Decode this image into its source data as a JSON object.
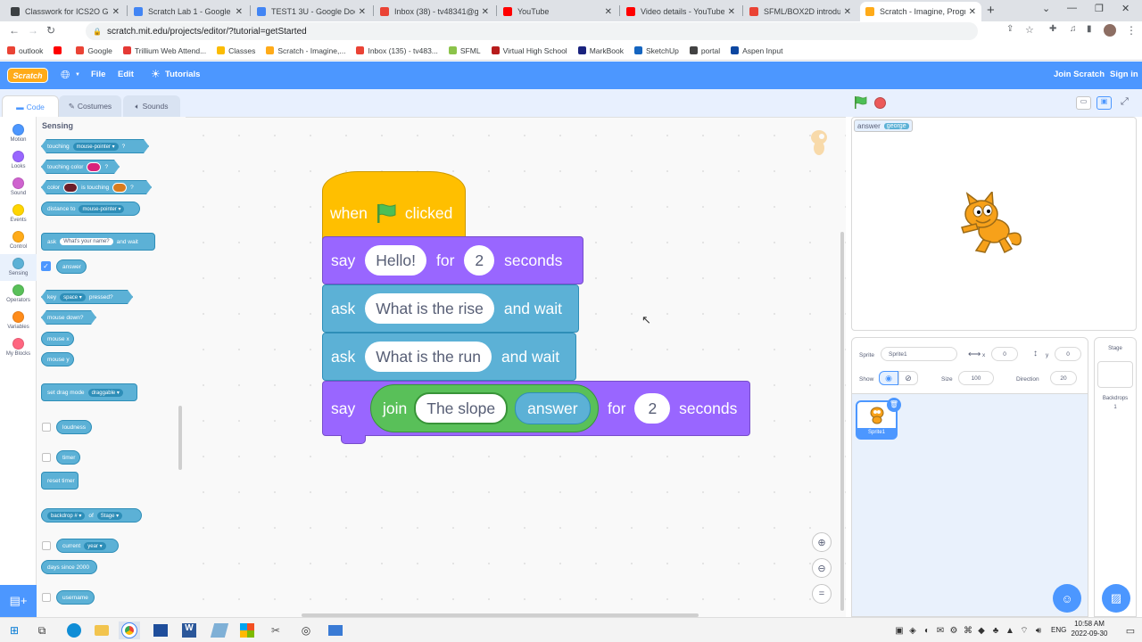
{
  "browser": {
    "tabs": [
      {
        "title": "Classwork for ICS2O Grade",
        "color": "#3c4043"
      },
      {
        "title": "Scratch Lab 1 - Google Do",
        "color": "#4285f4"
      },
      {
        "title": "TEST1 3U - Google Docs",
        "color": "#4285f4"
      },
      {
        "title": "Inbox (38) - tv48341@got",
        "color": "#ea4335"
      },
      {
        "title": "YouTube",
        "color": "#ff0000"
      },
      {
        "title": "Video details - YouTube St",
        "color": "#ff0000"
      },
      {
        "title": "SFML/BOX2D introduction",
        "color": "#ea4335"
      },
      {
        "title": "Scratch - Imagine, Program",
        "color": "#ffab19"
      }
    ],
    "url": "scratch.mit.edu/projects/editor/?tutorial=getStarted",
    "bookmarks": [
      {
        "label": "outlook",
        "color": "#ea4335"
      },
      {
        "label": "",
        "color": "#ff0000"
      },
      {
        "label": "Google",
        "color": "#ea4335"
      },
      {
        "label": "Trillium Web Attend...",
        "color": "#e53935"
      },
      {
        "label": "Classes",
        "color": "#fbbc04"
      },
      {
        "label": "Scratch - Imagine,...",
        "color": "#ffab19"
      },
      {
        "label": "Inbox (135) - tv483...",
        "color": "#ea4335"
      },
      {
        "label": "SFML",
        "color": "#8bc34a"
      },
      {
        "label": "Virtual High School",
        "color": "#b71c1c"
      },
      {
        "label": "MarkBook",
        "color": "#1a237e"
      },
      {
        "label": "SketchUp",
        "color": "#1565c0"
      },
      {
        "label": "portal",
        "color": "#424242"
      },
      {
        "label": "Aspen Input",
        "color": "#0d47a1"
      }
    ]
  },
  "menu": {
    "logo": "Scratch",
    "file": "File",
    "edit": "Edit",
    "tutorials": "Tutorials",
    "join": "Join Scratch",
    "signin": "Sign in"
  },
  "editor_tabs": {
    "code": "Code",
    "costumes": "Costumes",
    "sounds": "Sounds"
  },
  "categories": [
    {
      "label": "Motion",
      "color": "#4c97ff"
    },
    {
      "label": "Looks",
      "color": "#9966ff"
    },
    {
      "label": "Sound",
      "color": "#cf63cf"
    },
    {
      "label": "Events",
      "color": "#ffd500"
    },
    {
      "label": "Control",
      "color": "#ffab19"
    },
    {
      "label": "Sensing",
      "color": "#5cb1d6"
    },
    {
      "label": "Operators",
      "color": "#59c059"
    },
    {
      "label": "Variables",
      "color": "#ff8c1a"
    },
    {
      "label": "My Blocks",
      "color": "#ff6680"
    }
  ],
  "palette": {
    "heading": "Sensing",
    "touching": "touching",
    "mouse_pointer": "mouse-pointer",
    "touching_color": "touching color",
    "color": "color",
    "is_touching": "is touching",
    "distance_to": "distance to",
    "ask": "ask",
    "ask_default": "What's your name?",
    "and_wait": "and wait",
    "answer": "answer",
    "key": "key",
    "space": "space",
    "pressed": "pressed?",
    "mouse_down": "mouse down?",
    "mouse_x": "mouse x",
    "mouse_y": "mouse y",
    "set_drag_mode": "set drag mode",
    "draggable": "draggable",
    "loudness": "loudness",
    "timer": "timer",
    "reset_timer": "reset timer",
    "backdrop": "backdrop #",
    "of": "of",
    "stage": "Stage",
    "current": "current",
    "year": "year",
    "days_since": "days since 2000",
    "username": "username",
    "q": "?"
  },
  "script": {
    "when": "when",
    "clicked": "clicked",
    "say": "say",
    "hello": "Hello!",
    "for": "for",
    "secs1": "2",
    "seconds": "seconds",
    "ask": "ask",
    "rise": "What is the rise",
    "and_wait": "and wait",
    "run": "What is the run",
    "join": "join",
    "slope": "The slope",
    "answer": "answer",
    "secs2": "2"
  },
  "stage": {
    "monitor_label": "answer",
    "monitor_value": "george"
  },
  "sprite_info": {
    "sprite_label": "Sprite",
    "sprite_name": "Sprite1",
    "x_label": "x",
    "x": "0",
    "y_label": "y",
    "y": "0",
    "show_label": "Show",
    "size_label": "Size",
    "size": "100",
    "direction_label": "Direction",
    "direction": "20",
    "card_name": "Sprite1"
  },
  "stage_panel": {
    "title": "Stage",
    "backdrops_label": "Backdrops",
    "backdrops_count": "1"
  },
  "taskbar": {
    "lang": "ENG",
    "time": "10:58 AM",
    "date": "2022-09-30"
  }
}
